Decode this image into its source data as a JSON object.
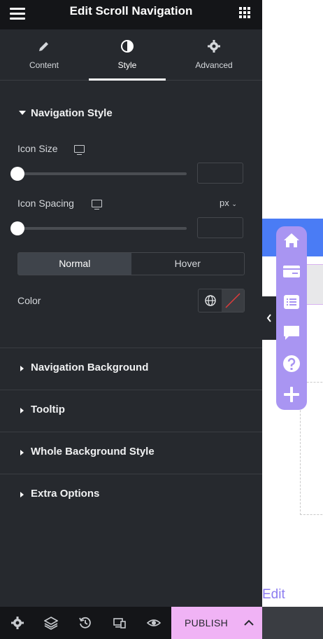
{
  "header": {
    "title": "Edit Scroll Navigation"
  },
  "tabs": [
    {
      "label": "Content"
    },
    {
      "label": "Style"
    },
    {
      "label": "Advanced"
    }
  ],
  "navigation_style": {
    "title": "Navigation Style",
    "icon_size_label": "Icon Size",
    "icon_spacing_label": "Icon Spacing",
    "unit": "px",
    "state_tabs": [
      "Normal",
      "Hover"
    ],
    "color_label": "Color"
  },
  "sections": [
    {
      "label": "Navigation Background"
    },
    {
      "label": "Tooltip"
    },
    {
      "label": "Whole Background Style"
    },
    {
      "label": "Extra Options"
    }
  ],
  "footer": {
    "publish_label": "PUBLISH"
  },
  "preview": {
    "edit_label": "Edit"
  },
  "colors": {
    "panel_bg": "#26292e",
    "topbar_bg": "#141518",
    "publish_bg": "#f0b3f5",
    "nav_pill": "#a995f2",
    "blue_bar": "#4a7cf5"
  }
}
